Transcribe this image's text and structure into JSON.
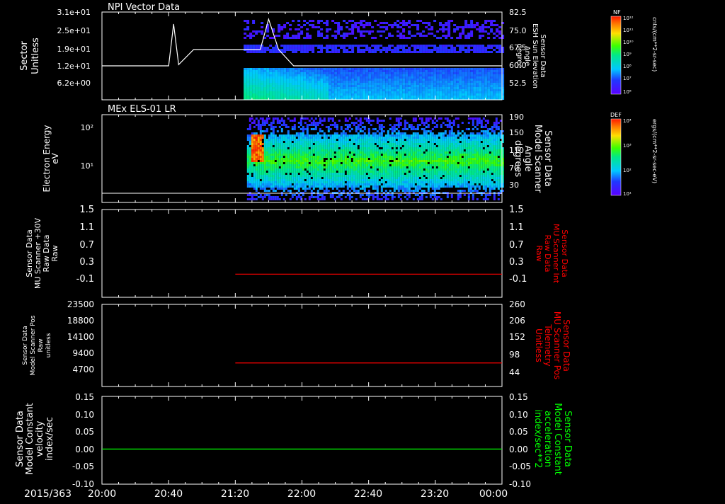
{
  "date_label": "2015/363",
  "x_ticks": [
    "20:00",
    "20:40",
    "21:20",
    "22:00",
    "22:40",
    "23:20",
    "00:00"
  ],
  "colors": {
    "white": "#ffffff",
    "red": "#ff0000",
    "green": "#00ff00"
  },
  "panels": {
    "p1": {
      "title": "NPI Vector Data",
      "left_label_lines": [
        "Sector",
        "Unitless"
      ],
      "left_ticks": [
        "3.1e+01",
        "2.5e+01",
        "1.9e+01",
        "1.2e+01",
        "6.2e+00"
      ],
      "right_label_lines": [
        "Sensor Data",
        "ESH Sun Elevation",
        "Angle",
        "degree"
      ],
      "right_ticks": [
        "82.5",
        "75.0",
        "67.5",
        "60.0",
        "52.5"
      ],
      "colorbar_title": "NF",
      "colorbar_ticks": [
        "10¹²",
        "10¹¹",
        "10¹⁰",
        "10⁹",
        "10⁸",
        "10⁷",
        "10⁶"
      ],
      "colorbar_units": "cnts/(cm**2-sr-sec)"
    },
    "p2": {
      "title": "MEx ELS-01 LR",
      "left_label_lines": [
        "Electron Energy",
        "eV"
      ],
      "left_ticks": [
        "10²",
        "10¹"
      ],
      "right_label_lines": [
        "Sensor Data",
        "Model Scanner",
        "Angle",
        "degrees"
      ],
      "right_ticks": [
        "190",
        "150",
        "110",
        "70",
        "30"
      ],
      "colorbar_title": "DEF",
      "colorbar_ticks": [
        "10⁴",
        "10³",
        "10²",
        "10¹"
      ],
      "colorbar_units": "ergs/(cm**2-sr-sec-eV)"
    },
    "p3": {
      "left_label_lines": [
        "Sensor Data",
        "MU Scanner +30V",
        "Raw Data",
        "Raw"
      ],
      "left_ticks": [
        "1.5",
        "1.1",
        "0.7",
        "0.3",
        "-0.1"
      ],
      "right_label_lines": [
        "Sensor Data",
        "MU Scanner Int",
        "Raw Data",
        "Raw"
      ],
      "right_ticks": [
        "1.5",
        "1.1",
        "0.7",
        "0.3",
        "-0.1"
      ]
    },
    "p4": {
      "left_label_lines": [
        "Sensor Data",
        "Model Scanner Pos",
        "Raw",
        "unitless"
      ],
      "left_ticks": [
        "23500",
        "18800",
        "14100",
        "9400",
        "4700"
      ],
      "right_label_lines": [
        "Sensor Data",
        "MU Scanner Pos",
        "Telemetry",
        "Unitless"
      ],
      "right_ticks": [
        "260",
        "206",
        "152",
        "98",
        "44"
      ]
    },
    "p5": {
      "left_label_lines": [
        "Sensor Data",
        "Model Constant",
        "velocity",
        "index/sec"
      ],
      "left_ticks": [
        "0.15",
        "0.10",
        "0.05",
        "0.00",
        "-0.05",
        "-0.10"
      ],
      "right_label_lines": [
        "Sensor Data",
        "Model Constant",
        "acceleration",
        "index/sec**2"
      ],
      "right_ticks": [
        "0.15",
        "0.10",
        "0.05",
        "0.00",
        "-0.05",
        "-0.10"
      ]
    }
  },
  "chart_data": [
    {
      "type": "heatmap",
      "title": "NPI Vector Data",
      "ylabel": "Sector Unitless",
      "y2label": "Sensor Data ESH Sun Elevation Angle degree",
      "colorbar": "NF cnts/(cm**2-sr-sec)",
      "overlay_line": {
        "x": [
          "20:00",
          "20:40",
          "20:43",
          "20:46",
          "20:55",
          "21:20",
          "21:35",
          "21:40",
          "21:46",
          "21:55",
          "22:00",
          "00:00"
        ],
        "y": [
          60.0,
          60.0,
          77.5,
          60.5,
          66.8,
          66.8,
          66.8,
          79.5,
          66.8,
          60.0,
          60.0,
          60.0
        ]
      }
    },
    {
      "type": "heatmap",
      "title": "MEx ELS-01 LR",
      "ylabel": "Electron Energy eV",
      "y2label": "Sensor Data Model Scanner Angle degrees",
      "colorbar": "DEF ergs/(cm**2-sr-sec-eV)",
      "overlay_line": {
        "x": [
          "20:00",
          "00:00"
        ],
        "y": [
          10,
          10
        ]
      }
    },
    {
      "type": "line",
      "ylabel": "Sensor Data MU Scanner +30V Raw Data Raw",
      "y2label": "Sensor Data MU Scanner Int Raw Data Raw",
      "ylim": [
        -0.3,
        1.5
      ],
      "series": [
        {
          "name": "Sensor Data MU Scanner Int Raw Data Raw",
          "x": [
            "21:20",
            "00:00"
          ],
          "values": [
            0.0,
            0.0
          ]
        }
      ]
    },
    {
      "type": "line",
      "ylabel": "Sensor Data Model Scanner Pos Raw unitless",
      "y2label": "Sensor Data MU Scanner Pos Telemetry Unitless",
      "ylim": [
        0,
        23500
      ],
      "series": [
        {
          "name": "Sensor Data MU Scanner Pos Telemetry Unitless",
          "x": [
            "21:20",
            "00:00"
          ],
          "values": [
            81,
            81
          ]
        }
      ]
    },
    {
      "type": "line",
      "ylabel": "Sensor Data Model Constant velocity index/sec",
      "y2label": "Sensor Data Model Constant acceleration index/sec**2",
      "ylim": [
        -0.1,
        0.15
      ],
      "series": [
        {
          "name": "Sensor Data Model Constant acceleration index/sec**2",
          "x": [
            "20:00",
            "00:00"
          ],
          "values": [
            0.0,
            0.0
          ]
        }
      ]
    }
  ]
}
